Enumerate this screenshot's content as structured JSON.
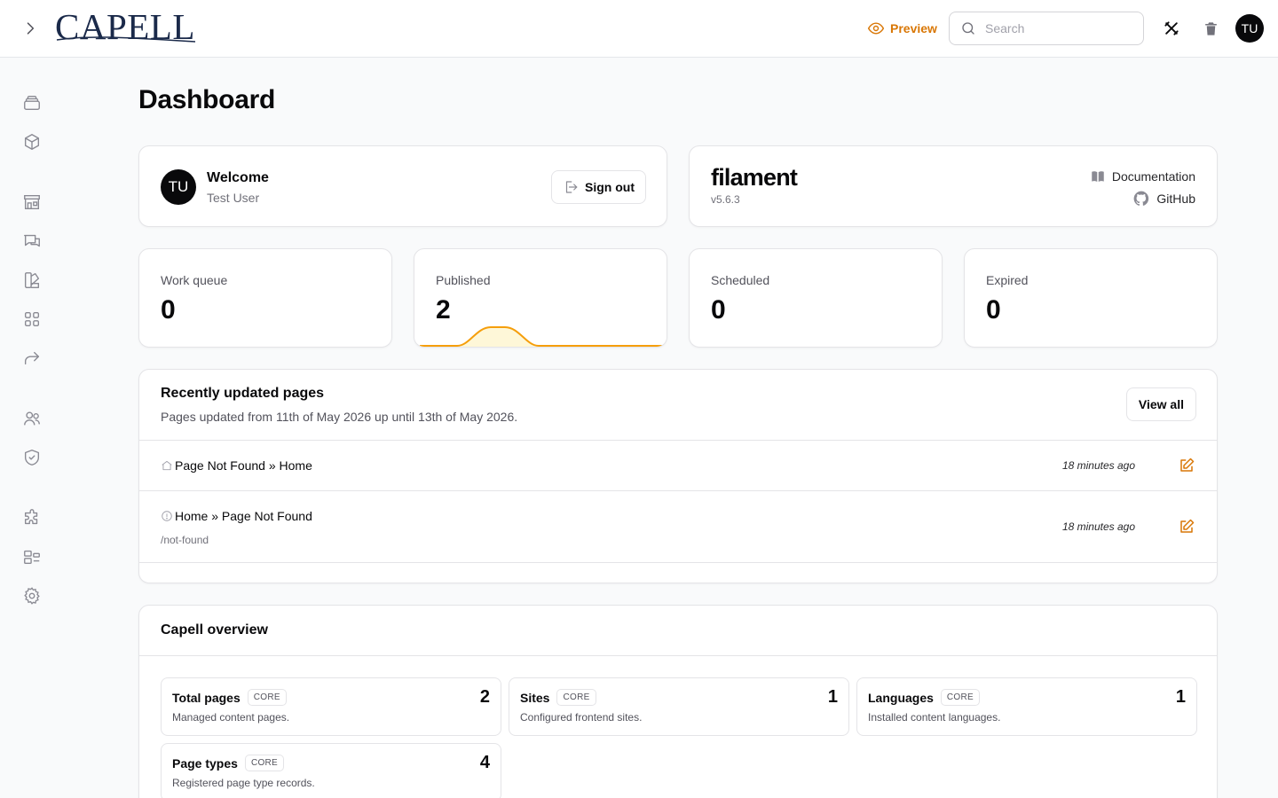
{
  "app": {
    "logo_text": "CAPELL"
  },
  "topbar": {
    "preview_label": "Preview",
    "search_placeholder": "Search",
    "user_initials": "TU",
    "accent_color": "#d97706"
  },
  "page": {
    "title": "Dashboard"
  },
  "welcome": {
    "initials": "TU",
    "title": "Welcome",
    "user_name": "Test User",
    "sign_out_label": "Sign out"
  },
  "filament": {
    "logo_text": "filament",
    "version": "v5.6.3",
    "documentation_label": "Documentation",
    "github_label": "GitHub"
  },
  "stats": [
    {
      "label": "Work queue",
      "value": "0"
    },
    {
      "label": "Published",
      "value": "2"
    },
    {
      "label": "Scheduled",
      "value": "0"
    },
    {
      "label": "Expired",
      "value": "0"
    }
  ],
  "recent_pages": {
    "title": "Recently updated pages",
    "description": "Pages updated from 11th of May 2026 up until 13th of May 2026.",
    "view_all_label": "View all",
    "rows": [
      {
        "icon": "home-icon",
        "title": "Page Not Found » Home",
        "slug": "",
        "time": "18 minutes ago"
      },
      {
        "icon": "info-icon",
        "title": "Home » Page Not Found",
        "slug": "/not-found",
        "time": "18 minutes ago"
      }
    ]
  },
  "overview": {
    "title": "Capell overview",
    "items": [
      {
        "title": "Total pages",
        "badge": "CORE",
        "description": "Managed content pages.",
        "count": "2"
      },
      {
        "title": "Sites",
        "badge": "CORE",
        "description": "Configured frontend sites.",
        "count": "1"
      },
      {
        "title": "Languages",
        "badge": "CORE",
        "description": "Installed content languages.",
        "count": "1"
      },
      {
        "title": "Page types",
        "badge": "CORE",
        "description": "Registered page type records.",
        "count": "4"
      }
    ]
  },
  "sidebar_icons": [
    "layers-icon",
    "cube-icon",
    "storefront-icon",
    "chat-bubbles-icon",
    "swatch-icon",
    "grid-icon",
    "share-arrow-icon",
    "users-icon",
    "shield-check-icon",
    "puzzle-icon",
    "layout-icon",
    "settings-icon"
  ]
}
